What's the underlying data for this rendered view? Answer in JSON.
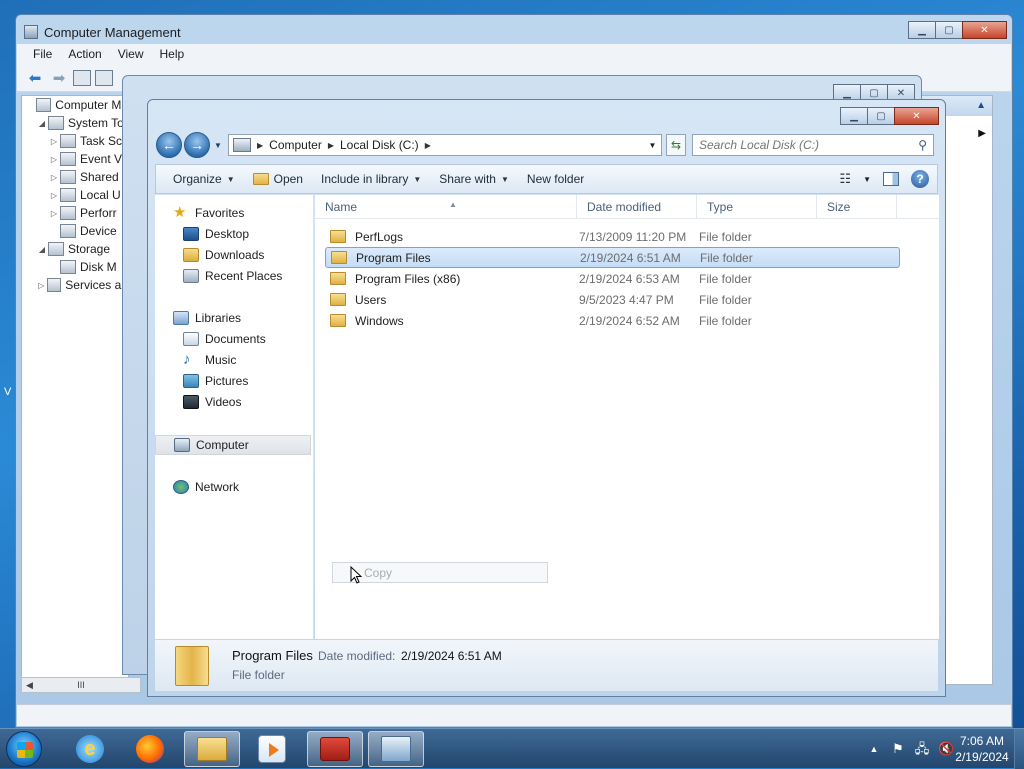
{
  "desktop": {
    "edge_text": "V"
  },
  "cm_window": {
    "title": "Computer Management",
    "menu": [
      "File",
      "Action",
      "View",
      "Help"
    ],
    "tree": [
      {
        "label": "Computer Ma",
        "level": 0,
        "arrow": ""
      },
      {
        "label": "System To",
        "level": 1,
        "arrow": "◢"
      },
      {
        "label": "Task Sc",
        "level": 2,
        "arrow": "▷"
      },
      {
        "label": "Event V",
        "level": 2,
        "arrow": "▷"
      },
      {
        "label": "Shared",
        "level": 2,
        "arrow": "▷"
      },
      {
        "label": "Local U",
        "level": 2,
        "arrow": "▷"
      },
      {
        "label": "Perforr",
        "level": 2,
        "arrow": "▷"
      },
      {
        "label": "Device",
        "level": 2,
        "arrow": ""
      },
      {
        "label": "Storage",
        "level": 1,
        "arrow": "◢"
      },
      {
        "label": "Disk M",
        "level": 2,
        "arrow": ""
      },
      {
        "label": "Services an",
        "level": 1,
        "arrow": "▷"
      }
    ],
    "scroll_grip": "III"
  },
  "explorer": {
    "address": {
      "segments": [
        "Computer",
        "Local Disk (C:)"
      ]
    },
    "search": {
      "placeholder": "Search Local Disk (C:)"
    },
    "commands": {
      "organize": "Organize",
      "open": "Open",
      "include": "Include in library",
      "share": "Share with",
      "new_folder": "New folder"
    },
    "nav": {
      "favorites": "Favorites",
      "desktop": "Desktop",
      "downloads": "Downloads",
      "recent": "Recent Places",
      "libraries": "Libraries",
      "documents": "Documents",
      "music": "Music",
      "pictures": "Pictures",
      "videos": "Videos",
      "computer": "Computer",
      "network": "Network"
    },
    "columns": {
      "name": "Name",
      "date": "Date modified",
      "type": "Type",
      "size": "Size"
    },
    "rows": [
      {
        "name": "PerfLogs",
        "date": "7/13/2009 11:20 PM",
        "type": "File folder",
        "selected": false
      },
      {
        "name": "Program Files",
        "date": "2/19/2024 6:51 AM",
        "type": "File folder",
        "selected": true
      },
      {
        "name": "Program Files (x86)",
        "date": "2/19/2024 6:53 AM",
        "type": "File folder",
        "selected": false
      },
      {
        "name": "Users",
        "date": "9/5/2023 4:47 PM",
        "type": "File folder",
        "selected": false
      },
      {
        "name": "Windows",
        "date": "2/19/2024 6:52 AM",
        "type": "File folder",
        "selected": false
      }
    ],
    "drag_tooltip": "Copy",
    "details": {
      "name": "Program Files",
      "date_label": "Date modified:",
      "date_value": "2/19/2024 6:51 AM",
      "type": "File folder"
    }
  },
  "taskbar": {
    "clock_time": "7:06 AM",
    "clock_date": "2/19/2024"
  }
}
